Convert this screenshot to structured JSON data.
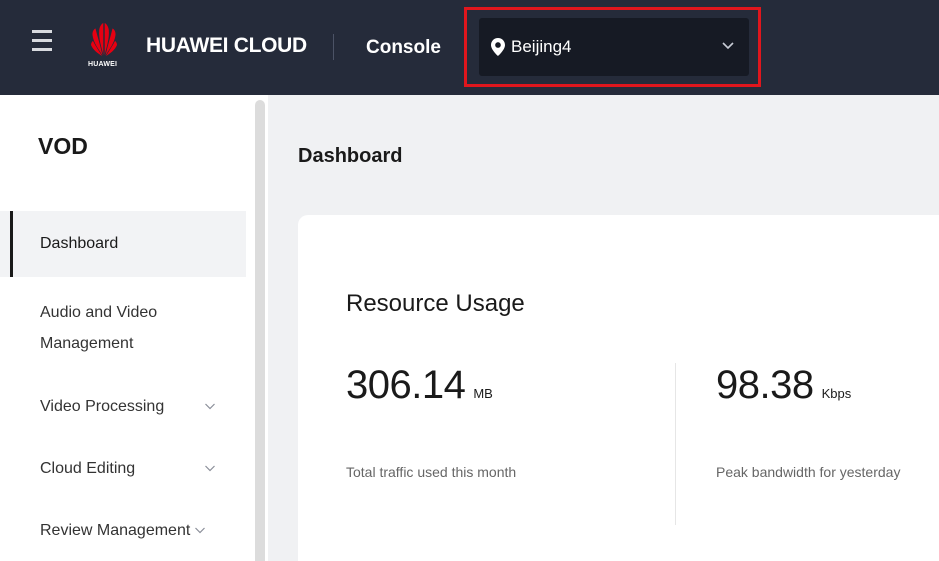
{
  "header": {
    "brand": "HUAWEI CLOUD",
    "logo_text": "HUAWEI",
    "console": "Console",
    "region": {
      "selected": "Beijing4",
      "icon": "location-pin-icon",
      "highlight_color": "#e0161d"
    }
  },
  "sidebar": {
    "title": "VOD",
    "items": [
      {
        "label": "Dashboard",
        "active": true,
        "expandable": false
      },
      {
        "label": "Audio and Video Management",
        "active": false,
        "expandable": false
      },
      {
        "label": "Video Processing",
        "active": false,
        "expandable": true
      },
      {
        "label": "Cloud Editing",
        "active": false,
        "expandable": true
      },
      {
        "label": "Review Management",
        "active": false,
        "expandable": true
      }
    ]
  },
  "main": {
    "page_title": "Dashboard",
    "resource_usage": {
      "title": "Resource Usage",
      "metrics": [
        {
          "value": "306.14",
          "unit": "MB",
          "description": "Total traffic used this month"
        },
        {
          "value": "98.38",
          "unit": "Kbps",
          "description": "Peak bandwidth for yesterday"
        }
      ]
    }
  },
  "colors": {
    "topbar_bg": "#252b3a",
    "region_select_bg": "#161a24",
    "main_bg": "#f0f1f3",
    "logo_red": "#e60012"
  }
}
